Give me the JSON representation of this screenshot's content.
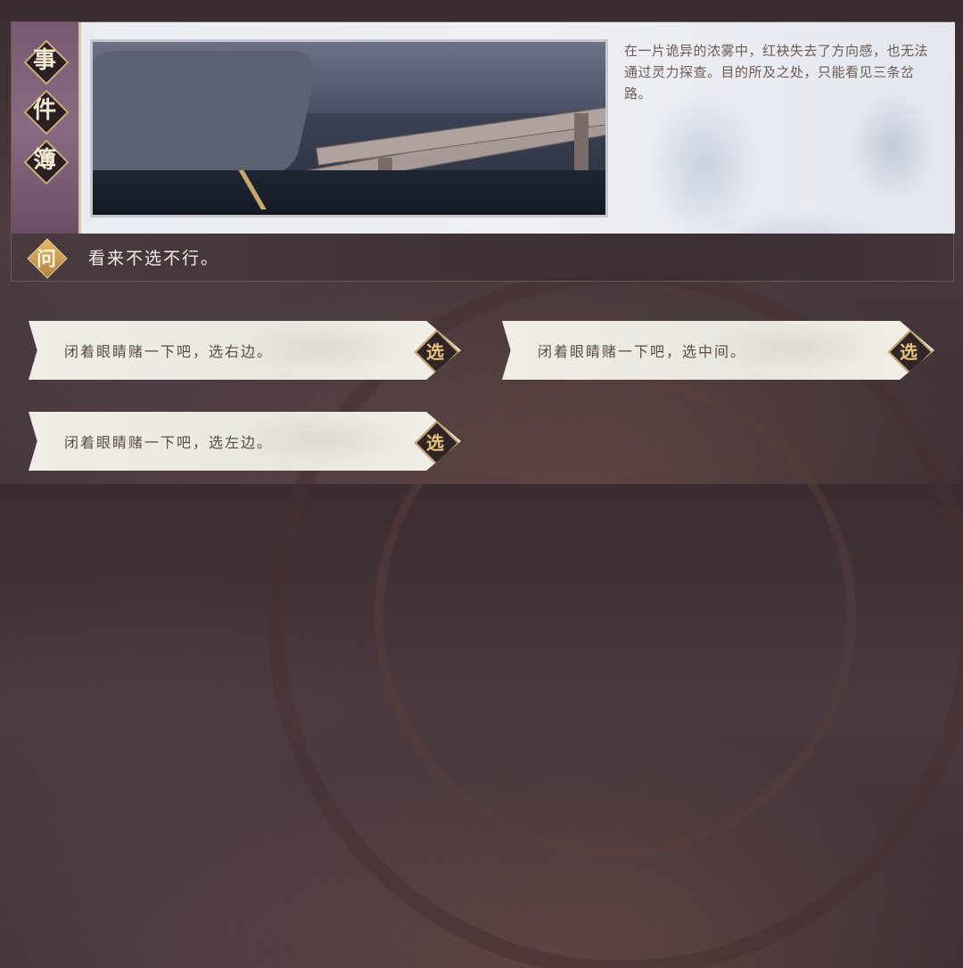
{
  "event_panel": {
    "title_chars": [
      "事",
      "件",
      "簿"
    ],
    "description": "在一片诡异的浓雾中，红袂失去了方向感，也无法通过灵力探查。目的所及之处，只能看见三条岔路。"
  },
  "question": {
    "icon_char": "问",
    "text": "看来不选不行。"
  },
  "choices": [
    {
      "text": "闭着眼睛赌一下吧，选右边。",
      "button": "选"
    },
    {
      "text": "闭着眼睛赌一下吧，选中间。",
      "button": "选"
    },
    {
      "text": "闭着眼睛赌一下吧，选左边。",
      "button": "选"
    }
  ],
  "colors": {
    "accent_gold": "#caa869",
    "panel_dark": "#3f3236",
    "side_strip_purple": "#7a5a73"
  }
}
